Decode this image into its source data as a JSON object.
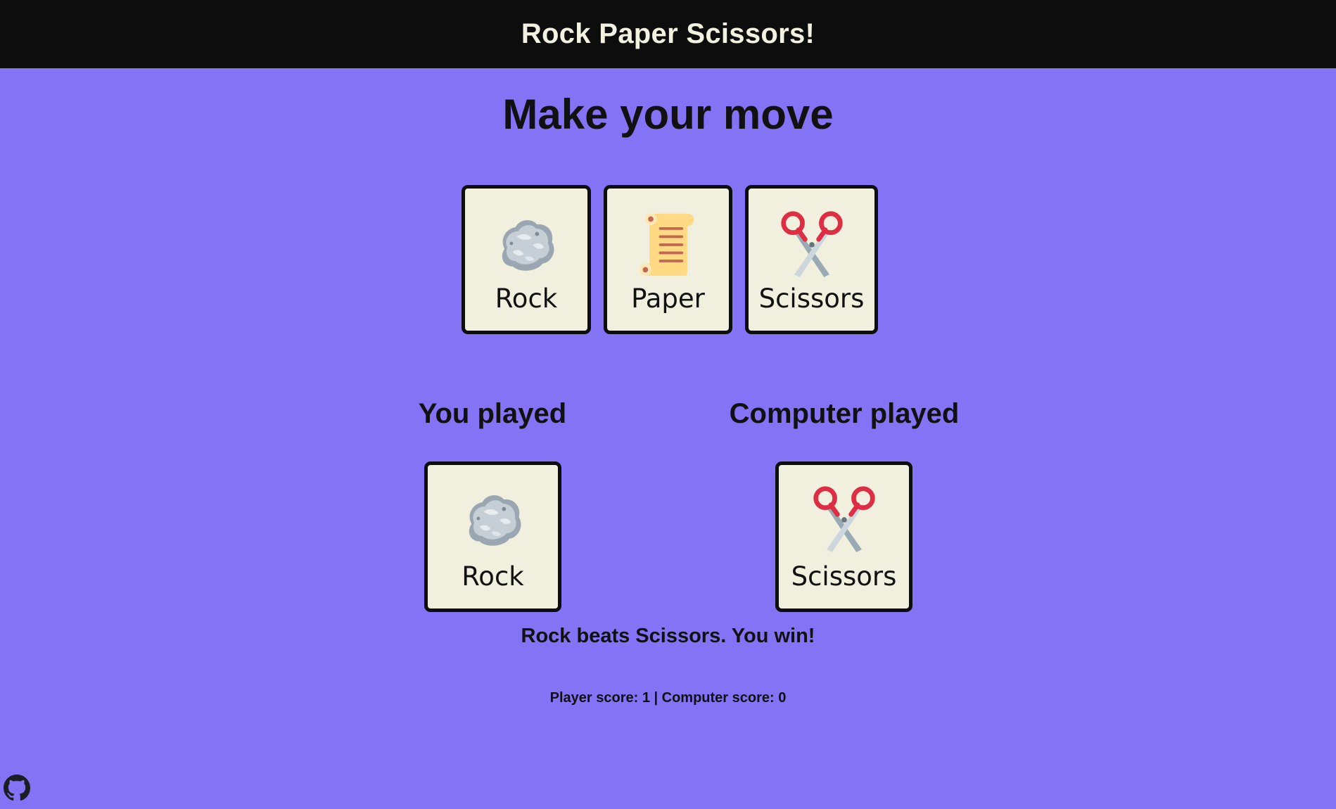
{
  "header": {
    "title": "Rock Paper Scissors!"
  },
  "main": {
    "heading": "Make your move",
    "choices": [
      {
        "label": "Rock",
        "icon": "rock-icon"
      },
      {
        "label": "Paper",
        "icon": "scroll-icon"
      },
      {
        "label": "Scissors",
        "icon": "scissors-icon"
      }
    ]
  },
  "results": {
    "player_heading": "You played",
    "computer_heading": "Computer played",
    "player_choice": {
      "label": "Rock",
      "icon": "rock-icon"
    },
    "computer_choice": {
      "label": "Scissors",
      "icon": "scissors-icon"
    },
    "message": "Rock beats Scissors. You win!"
  },
  "score": {
    "text": "Player score: 1 | Computer score: 0"
  },
  "footer": {
    "icon": "github-icon"
  },
  "colors": {
    "background": "#8573f5",
    "header_bg": "#0d0d0d",
    "header_text": "#f3f1df",
    "card_bg": "#f1f0df",
    "card_border": "#0d0d0d"
  }
}
